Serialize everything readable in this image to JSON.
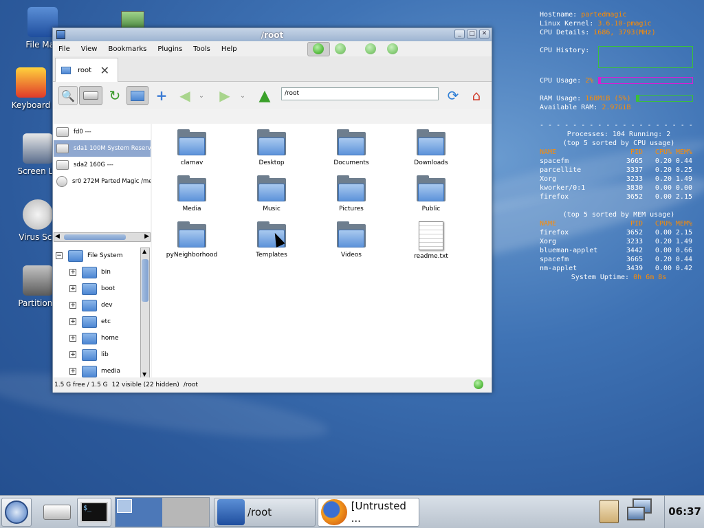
{
  "desktop": {
    "icons": [
      {
        "label": "File Man",
        "icon": "file-manager-icon"
      },
      {
        "label": "Keyboard",
        "icon": "keyboard-icon"
      },
      {
        "label": "Screen La",
        "icon": "monitor-icon"
      },
      {
        "label": "Virus Sca",
        "icon": "virus-scan-icon"
      },
      {
        "label": "Partition I",
        "icon": "partition-icon"
      }
    ]
  },
  "conky": {
    "hostname_label": "Hostname:",
    "hostname": "partedmagic",
    "kernel_label": "Linux Kernel:",
    "kernel": "3.6.10-pmagic",
    "cpu_label": "CPU Details:",
    "cpu": "i686, 3793(MHz)",
    "cpu_history_label": "CPU History:",
    "cpu_usage_label": "CPU Usage:",
    "cpu_usage": "2%",
    "cpu_usage_fraction": 0.02,
    "ram_usage_label": "RAM Usage:",
    "ram_usage": "168MiB (5%)",
    "ram_usage_fraction": 0.05,
    "available_ram_label": "Available RAM:",
    "available_ram": "2.97GiB",
    "separator": "- - - - - - - - - - - - - - - - - - - - - - - - - - - -",
    "processes_line": "Processes: 104  Running: 2",
    "cpu_top_title": "(top 5 sorted by CPU usage)",
    "mem_top_title": "(top 5 sorted by MEM usage)",
    "headers": [
      "NAME",
      "PID",
      "CPU%",
      "MEM%"
    ],
    "cpu_top": [
      [
        "spacefm",
        "3665",
        "0.20",
        "0.44"
      ],
      [
        "parcellite",
        "3337",
        "0.20",
        "0.25"
      ],
      [
        "Xorg",
        "3233",
        "0.20",
        "1.49"
      ],
      [
        "kworker/0:1",
        "3830",
        "0.00",
        "0.00"
      ],
      [
        "firefox",
        "3652",
        "0.00",
        "2.15"
      ]
    ],
    "mem_top": [
      [
        "firefox",
        "3652",
        "0.00",
        "2.15"
      ],
      [
        "Xorg",
        "3233",
        "0.20",
        "1.49"
      ],
      [
        "blueman-applet",
        "3442",
        "0.00",
        "0.66"
      ],
      [
        "spacefm",
        "3665",
        "0.20",
        "0.44"
      ],
      [
        "nm-applet",
        "3439",
        "0.00",
        "0.42"
      ]
    ],
    "uptime_label": "System Uptime:",
    "uptime": "0h 6m 8s"
  },
  "window": {
    "title": "/root",
    "menu": [
      "File",
      "View",
      "Bookmarks",
      "Plugins",
      "Tools",
      "Help"
    ],
    "tab_label": "root",
    "path": "/root",
    "devices": [
      {
        "label": "fd0 ---",
        "selected": false
      },
      {
        "label": "sda1 100M System Reserved",
        "selected": true
      },
      {
        "label": "sda2 160G ---",
        "selected": false
      },
      {
        "label": "sr0 272M Parted Magic /me",
        "selected": false
      }
    ],
    "tree_root": "File System",
    "tree": [
      "bin",
      "boot",
      "dev",
      "etc",
      "home",
      "lib",
      "media"
    ],
    "files": [
      {
        "name": "clamav",
        "type": "folder"
      },
      {
        "name": "Desktop",
        "type": "folder"
      },
      {
        "name": "Documents",
        "type": "folder"
      },
      {
        "name": "Downloads",
        "type": "folder"
      },
      {
        "name": "Media",
        "type": "folder"
      },
      {
        "name": "Music",
        "type": "folder"
      },
      {
        "name": "Pictures",
        "type": "folder"
      },
      {
        "name": "Public",
        "type": "folder"
      },
      {
        "name": "pyNeighborhood",
        "type": "folder"
      },
      {
        "name": "Templates",
        "type": "folder"
      },
      {
        "name": "Videos",
        "type": "folder"
      },
      {
        "name": "readme.txt",
        "type": "file"
      }
    ],
    "status": {
      "free": "1.5 G free / 1.5 G",
      "visible": "12 visible (22 hidden)",
      "path": "/root"
    }
  },
  "taskbar": {
    "tasks": [
      {
        "label": "/root",
        "icon": "file-manager-icon"
      },
      {
        "label": "[Untrusted ...",
        "icon": "firefox-icon"
      }
    ],
    "clock": "06:37"
  },
  "colors": {
    "accent_orange": "#ff8c00",
    "selection": "#8fa8d0"
  }
}
